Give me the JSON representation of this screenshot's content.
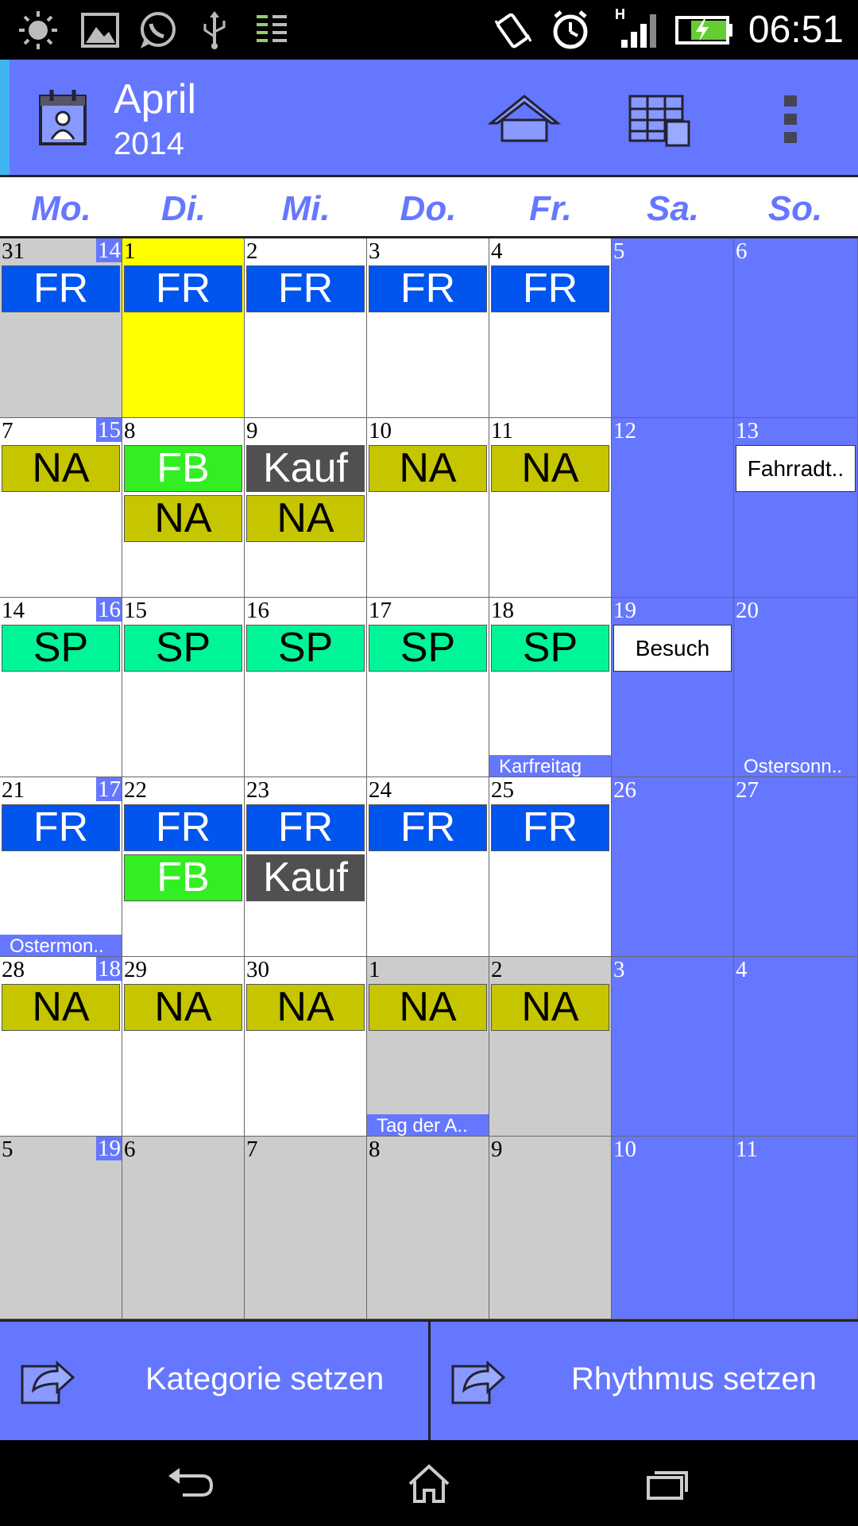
{
  "status_bar": {
    "time": "06:51",
    "network_label": "H",
    "icons": [
      "brightness-icon",
      "gallery-icon",
      "whatsapp-icon",
      "usb-icon",
      "data-sync-icon",
      "vibrate-icon",
      "alarm-icon",
      "signal-icon",
      "battery-charging-icon"
    ]
  },
  "action_bar": {
    "month": "April",
    "year": "2014",
    "actions": [
      "home-icon",
      "calendar-view-icon",
      "overflow-menu-icon"
    ]
  },
  "weekdays": [
    "Mo.",
    "Di.",
    "Mi.",
    "Do.",
    "Fr.",
    "Sa.",
    "So."
  ],
  "colors": {
    "accent": "#6677ff",
    "today": "#ffff00",
    "other_month": "#cccccc",
    "FR": "#0055ee",
    "NA": "#c5c500",
    "FB": "#33ee22",
    "Kauf": "#505050",
    "SP": "#00f596"
  },
  "weeks": [
    {
      "kw": "14",
      "days": [
        {
          "d": "31",
          "s": "grey",
          "ev": [
            "FR"
          ]
        },
        {
          "d": "1",
          "s": "today",
          "ev": [
            "FR"
          ]
        },
        {
          "d": "2",
          "s": "white",
          "ev": [
            "FR"
          ]
        },
        {
          "d": "3",
          "s": "white",
          "ev": [
            "FR"
          ]
        },
        {
          "d": "4",
          "s": "white",
          "ev": [
            "FR"
          ]
        },
        {
          "d": "5",
          "s": "blue",
          "ev": []
        },
        {
          "d": "6",
          "s": "blue",
          "ev": []
        }
      ]
    },
    {
      "kw": "15",
      "days": [
        {
          "d": "7",
          "s": "white",
          "ev": [
            "NA"
          ]
        },
        {
          "d": "8",
          "s": "white",
          "ev": [
            "FB",
            "NA"
          ]
        },
        {
          "d": "9",
          "s": "white",
          "ev": [
            "Kauf",
            "NA"
          ]
        },
        {
          "d": "10",
          "s": "white",
          "ev": [
            "NA"
          ]
        },
        {
          "d": "11",
          "s": "white",
          "ev": [
            "NA"
          ]
        },
        {
          "d": "12",
          "s": "blue",
          "ev": []
        },
        {
          "d": "13",
          "s": "blue",
          "ev": [],
          "note": "Fahrradt.."
        }
      ]
    },
    {
      "kw": "16",
      "days": [
        {
          "d": "14",
          "s": "white",
          "ev": [
            "SP"
          ]
        },
        {
          "d": "15",
          "s": "white",
          "ev": [
            "SP"
          ]
        },
        {
          "d": "16",
          "s": "white",
          "ev": [
            "SP"
          ]
        },
        {
          "d": "17",
          "s": "white",
          "ev": [
            "SP"
          ]
        },
        {
          "d": "18",
          "s": "white",
          "ev": [
            "SP"
          ],
          "holiday": "Karfreitag"
        },
        {
          "d": "19",
          "s": "blue",
          "ev": [],
          "note": "Besuch"
        },
        {
          "d": "20",
          "s": "blue",
          "ev": [],
          "holiday": "Ostersonn.."
        }
      ]
    },
    {
      "kw": "17",
      "days": [
        {
          "d": "21",
          "s": "white",
          "ev": [
            "FR"
          ],
          "holiday": "Ostermon.."
        },
        {
          "d": "22",
          "s": "white",
          "ev": [
            "FR",
            "FB"
          ]
        },
        {
          "d": "23",
          "s": "white",
          "ev": [
            "FR",
            "Kauf"
          ]
        },
        {
          "d": "24",
          "s": "white",
          "ev": [
            "FR"
          ]
        },
        {
          "d": "25",
          "s": "white",
          "ev": [
            "FR"
          ]
        },
        {
          "d": "26",
          "s": "blue",
          "ev": []
        },
        {
          "d": "27",
          "s": "blue",
          "ev": []
        }
      ]
    },
    {
      "kw": "18",
      "days": [
        {
          "d": "28",
          "s": "white",
          "ev": [
            "NA"
          ]
        },
        {
          "d": "29",
          "s": "white",
          "ev": [
            "NA"
          ]
        },
        {
          "d": "30",
          "s": "white",
          "ev": [
            "NA"
          ]
        },
        {
          "d": "1",
          "s": "grey",
          "ev": [
            "NA"
          ],
          "holiday": "Tag der A.."
        },
        {
          "d": "2",
          "s": "grey",
          "ev": [
            "NA"
          ]
        },
        {
          "d": "3",
          "s": "blue",
          "ev": []
        },
        {
          "d": "4",
          "s": "blue",
          "ev": []
        }
      ]
    },
    {
      "kw": "19",
      "days": [
        {
          "d": "5",
          "s": "grey",
          "ev": []
        },
        {
          "d": "6",
          "s": "grey",
          "ev": []
        },
        {
          "d": "7",
          "s": "grey",
          "ev": []
        },
        {
          "d": "8",
          "s": "grey",
          "ev": []
        },
        {
          "d": "9",
          "s": "grey",
          "ev": []
        },
        {
          "d": "10",
          "s": "blue",
          "ev": []
        },
        {
          "d": "11",
          "s": "blue",
          "ev": []
        }
      ]
    }
  ],
  "bottom_buttons": {
    "category": "Kategorie setzen",
    "rhythm": "Rhythmus setzen"
  },
  "nav_bar": [
    "back-icon",
    "home-icon",
    "recents-icon"
  ]
}
